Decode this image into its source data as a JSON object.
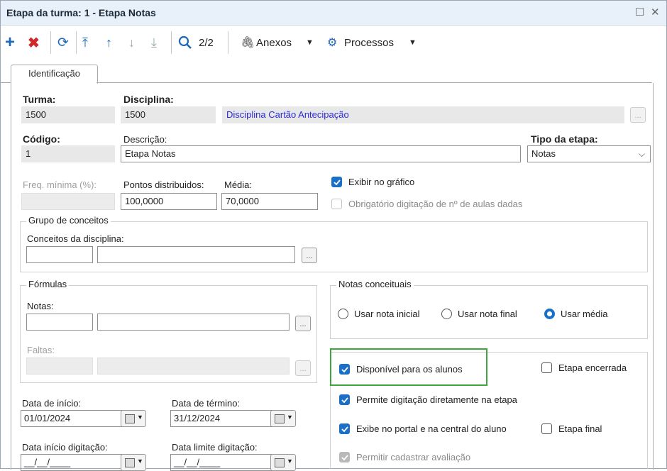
{
  "window": {
    "title": "Etapa da turma: 1 - Etapa Notas"
  },
  "toolbar": {
    "pager": "2/2",
    "anexos_label": "Anexos",
    "processos_label": "Processos"
  },
  "tabs": [
    {
      "label": "Identificação"
    }
  ],
  "form": {
    "turma": {
      "label": "Turma:",
      "value": "1500"
    },
    "disciplina": {
      "label": "Disciplina:",
      "code": "1500",
      "name": "Disciplina Cartão Antecipação"
    },
    "codigo": {
      "label": "Código:",
      "value": "1"
    },
    "descricao": {
      "label": "Descrição:",
      "value": "Etapa Notas"
    },
    "tipo_etapa": {
      "label": "Tipo da etapa:",
      "value": "Notas"
    },
    "freq_minima": {
      "label": "Freq. mínima (%):",
      "value": ""
    },
    "pontos": {
      "label": "Pontos distribuidos:",
      "value": "100,0000"
    },
    "media": {
      "label": "Média:",
      "value": "70,0000"
    },
    "exibir_grafico": {
      "label": "Exibir no gráfico",
      "checked": true
    },
    "obrigatorio_aulas": {
      "label": "Obrigatório digitação de nº de aulas dadas",
      "checked": false
    },
    "grupo_conceitos": {
      "title": "Grupo de conceitos",
      "conceitos_label": "Conceitos da disciplina:"
    },
    "formulas": {
      "title": "Fórmulas",
      "notas_label": "Notas:",
      "faltas_label": "Faltas:"
    },
    "notas_conceituais": {
      "title": "Notas conceituais",
      "options": [
        "Usar nota inicial",
        "Usar nota final",
        "Usar média"
      ],
      "selected": "Usar média"
    },
    "disponivel_alunos": {
      "label": "Disponível para os alunos",
      "checked": true
    },
    "etapa_encerrada": {
      "label": "Etapa encerrada",
      "checked": false
    },
    "permite_digitacao": {
      "label": "Permite digitação diretamente na etapa",
      "checked": true
    },
    "exibe_portal": {
      "label": "Exibe no portal e na central do aluno",
      "checked": true
    },
    "etapa_final": {
      "label": "Etapa final",
      "checked": false
    },
    "permitir_avaliacao": {
      "label": "Permitir cadastrar avaliação",
      "checked": true
    },
    "data_inicio": {
      "label": "Data de início:",
      "value": "01/01/2024"
    },
    "data_termino": {
      "label": "Data de término:",
      "value": "31/12/2024"
    },
    "data_inicio_dig": {
      "label": "Data início digitação:",
      "value": "__/__/____"
    },
    "data_limite_dig": {
      "label": "Data limite digitação:",
      "value": "__/__/____"
    }
  },
  "colors": {
    "accent": "#1a6fc9",
    "highlight": "#3da63d",
    "link_blue": "#2b2bd6",
    "titlebar": "#e8f1fa"
  }
}
